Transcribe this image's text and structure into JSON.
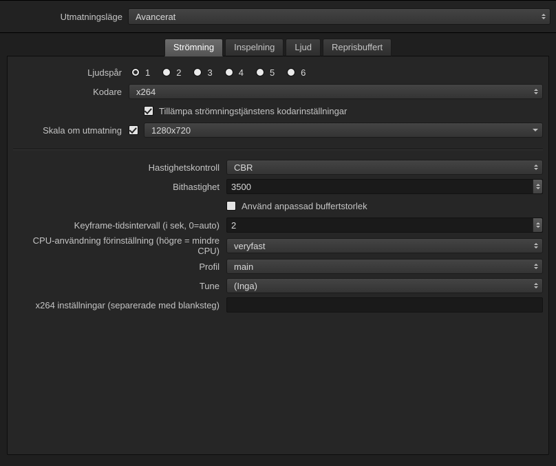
{
  "top": {
    "output_mode_label": "Utmatningsläge",
    "output_mode_value": "Avancerat"
  },
  "tabs": {
    "streaming": "Strömning",
    "recording": "Inspelning",
    "audio": "Ljud",
    "replay": "Reprisbuffert",
    "selected": "streaming"
  },
  "stream": {
    "audio_track_label": "Ljudspår",
    "audio_tracks": [
      "1",
      "2",
      "3",
      "4",
      "5",
      "6"
    ],
    "audio_track_selected": "1",
    "encoder_label": "Kodare",
    "encoder_value": "x264",
    "enforce_label": "Tillämpa strömningstjänstens kodarinställningar",
    "enforce_checked": true,
    "rescale_label": "Skala om utmatning",
    "rescale_checked": true,
    "rescale_value": "1280x720"
  },
  "enc": {
    "rate_control_label": "Hastighetskontroll",
    "rate_control_value": "CBR",
    "bitrate_label": "Bithastighet",
    "bitrate_value": "3500",
    "custom_buffer_label": "Använd anpassad buffertstorlek",
    "custom_buffer_checked": false,
    "keyframe_label": "Keyframe-tidsintervall (i sek, 0=auto)",
    "keyframe_value": "2",
    "cpu_preset_label": "CPU-användning förinställning (högre = mindre CPU)",
    "cpu_preset_value": "veryfast",
    "profile_label": "Profil",
    "profile_value": "main",
    "tune_label": "Tune",
    "tune_value": "(Inga)",
    "x264opts_label": "x264 inställningar (separerade med blanksteg)",
    "x264opts_value": ""
  }
}
